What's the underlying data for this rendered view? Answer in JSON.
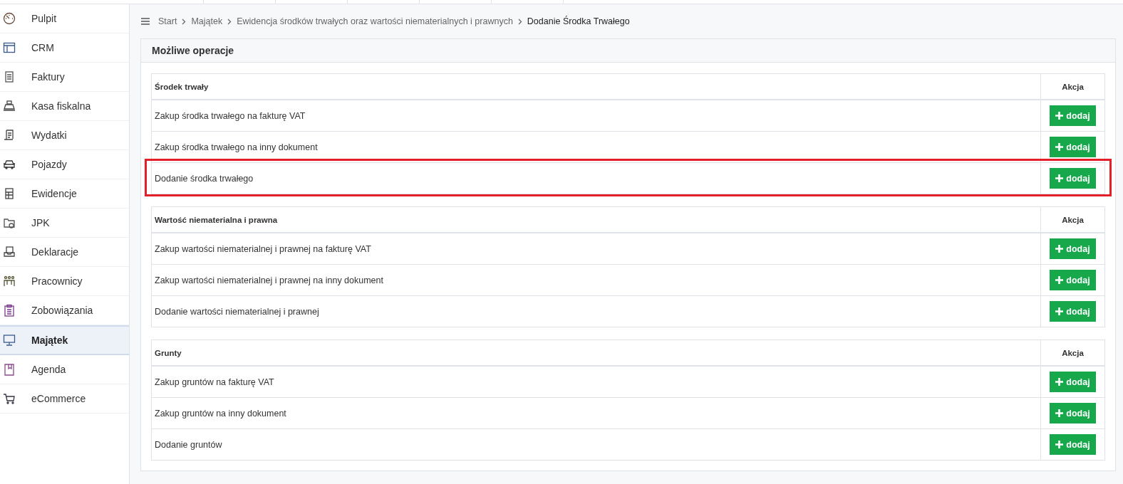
{
  "sidebar": {
    "items": [
      {
        "label": "Pulpit",
        "selected": false
      },
      {
        "label": "CRM",
        "selected": false
      },
      {
        "label": "Faktury",
        "selected": false
      },
      {
        "label": "Kasa fiskalna",
        "selected": false
      },
      {
        "label": "Wydatki",
        "selected": false
      },
      {
        "label": "Pojazdy",
        "selected": false
      },
      {
        "label": "Ewidencje",
        "selected": false
      },
      {
        "label": "JPK",
        "selected": false
      },
      {
        "label": "Deklaracje",
        "selected": false
      },
      {
        "label": "Pracownicy",
        "selected": false
      },
      {
        "label": "Zobowiązania",
        "selected": false
      },
      {
        "label": "Majątek",
        "selected": true
      },
      {
        "label": "Agenda",
        "selected": false
      },
      {
        "label": "eCommerce",
        "selected": false
      }
    ]
  },
  "breadcrumb": [
    "Start",
    "Majątek",
    "Ewidencja środków trwałych oraz wartości niematerialnych i prawnych",
    "Dodanie Środka Trwałego"
  ],
  "panel": {
    "title": "Możliwe operacje",
    "sections": [
      {
        "heading": "Środek trwały",
        "action_heading": "Akcja",
        "rows": [
          {
            "label": "Zakup środka trwałego na fakturę VAT",
            "button": "dodaj",
            "highlighted": false
          },
          {
            "label": "Zakup środka trwałego na inny dokument",
            "button": "dodaj",
            "highlighted": false
          },
          {
            "label": "Dodanie środka trwałego",
            "button": "dodaj",
            "highlighted": true
          }
        ]
      },
      {
        "heading": "Wartość niematerialna i prawna",
        "action_heading": "Akcja",
        "rows": [
          {
            "label": "Zakup wartości niematerialnej i prawnej na fakturę VAT",
            "button": "dodaj",
            "highlighted": false
          },
          {
            "label": "Zakup wartości niematerialnej i prawnej na inny dokument",
            "button": "dodaj",
            "highlighted": false
          },
          {
            "label": "Dodanie wartości niematerialnej i prawnej",
            "button": "dodaj",
            "highlighted": false
          }
        ]
      },
      {
        "heading": "Grunty",
        "action_heading": "Akcja",
        "rows": [
          {
            "label": "Zakup gruntów na fakturę VAT",
            "button": "dodaj",
            "highlighted": false
          },
          {
            "label": "Zakup gruntów na inny dokument",
            "button": "dodaj",
            "highlighted": false
          },
          {
            "label": "Dodanie gruntów",
            "button": "dodaj",
            "highlighted": false
          }
        ]
      }
    ]
  }
}
